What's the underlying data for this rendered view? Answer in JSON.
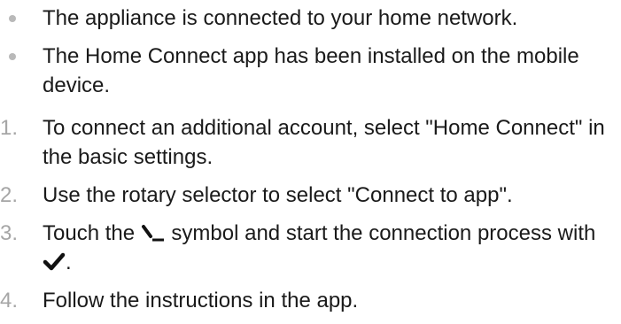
{
  "prerequisites": [
    "The appliance is connected to your home network.",
    "The Home Connect app has been installed on the mobile device."
  ],
  "steps": [
    {
      "number": "1.",
      "text": "To connect an additional account, select \"Home Connect\" in the basic settings."
    },
    {
      "number": "2.",
      "text": "Use the rotary selector to select \"Connect to app\"."
    },
    {
      "number": "3.",
      "text_before_icon": "Touch the",
      "icon": "connection-symbol-icon",
      "text_after_icon": "symbol and start the connection process with",
      "confirm_icon": "checkmark-icon",
      "text_end": "."
    },
    {
      "number": "4.",
      "text": "Follow the instructions in the app."
    }
  ]
}
